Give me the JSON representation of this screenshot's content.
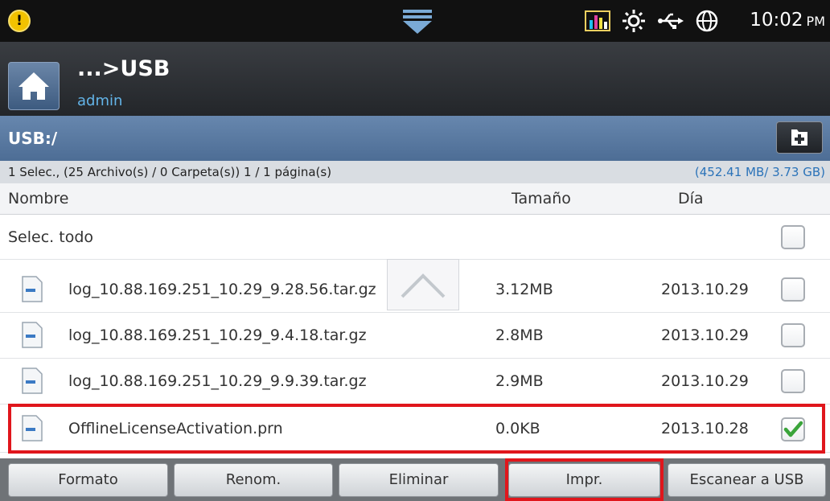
{
  "status_bar": {
    "time": "10:02",
    "ampm": "PM",
    "icons": [
      "alert-icon",
      "toner-level-icon",
      "brightness-icon",
      "usb-icon",
      "network-globe-icon"
    ]
  },
  "title_bar": {
    "path": "...>USB",
    "user": "admin"
  },
  "location": {
    "path": "USB:/"
  },
  "info": {
    "selection": "1 Selec., (25 Archivo(s) / 0 Carpeta(s)) 1 / 1 página(s)",
    "storage": "(452.41 MB/ 3.73 GB)"
  },
  "columns": {
    "name": "Nombre",
    "size": "Tamaño",
    "date": "Día"
  },
  "select_all": {
    "label": "Selec. todo",
    "checked": false
  },
  "files": [
    {
      "name": "log_10.88.169.251_10.29_9.28.56.tar.gz",
      "size": "3.12MB",
      "date": "2013.10.29",
      "checked": false
    },
    {
      "name": "log_10.88.169.251_10.29_9.4.18.tar.gz",
      "size": "2.8MB",
      "date": "2013.10.29",
      "checked": false
    },
    {
      "name": "log_10.88.169.251_10.29_9.9.39.tar.gz",
      "size": "2.9MB",
      "date": "2013.10.29",
      "checked": false
    },
    {
      "name": "OfflineLicenseActivation.prn",
      "size": "0.0KB",
      "date": "2013.10.28",
      "checked": true
    }
  ],
  "buttons": {
    "format": "Formato",
    "rename": "Renom.",
    "delete": "Eliminar",
    "print": "Impr.",
    "scan": "Escanear a USB"
  },
  "colors": {
    "highlight": "#e0161c",
    "storage_text": "#2b73b9",
    "user_text": "#63b4e8",
    "check_green": "#3aa43a"
  }
}
